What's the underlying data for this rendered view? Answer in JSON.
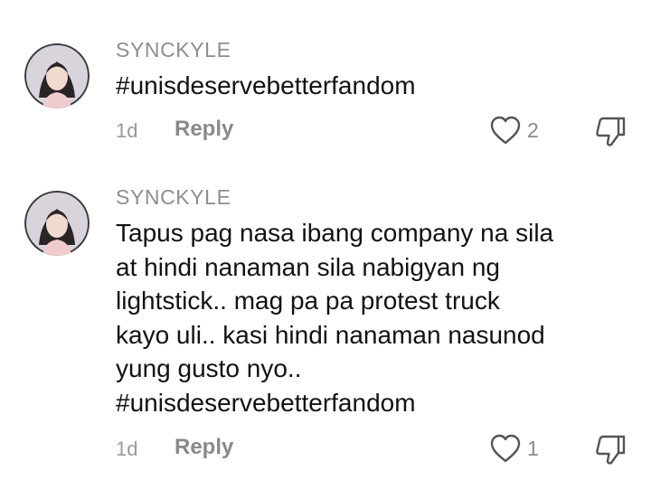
{
  "comments": [
    {
      "username": "SYNCKYLE",
      "text": "#unisdeservebetterfandom",
      "time": "1d",
      "reply_label": "Reply",
      "like_count": "2",
      "avatar_icon": "user-avatar-photo",
      "like_icon": "heart-outline-icon",
      "dislike_icon": "thumbs-down-outline-icon"
    },
    {
      "username": "SYNCKYLE",
      "text": "Tapus pag nasa ibang company na sila\nat hindi nanaman sila nabigyan ng\nlightstick.. mag pa pa protest truck\nkayo uli.. kasi hindi nanaman nasunod\nyung gusto nyo..\n#unisdeservebetterfandom",
      "time": "1d",
      "reply_label": "Reply",
      "like_count": "1",
      "avatar_icon": "user-avatar-photo",
      "like_icon": "heart-outline-icon",
      "dislike_icon": "thumbs-down-outline-icon"
    }
  ],
  "colors": {
    "username": "#8e8e8e",
    "body": "#121212",
    "meta": "#8a8a8a",
    "icon_stroke": "#555555"
  }
}
